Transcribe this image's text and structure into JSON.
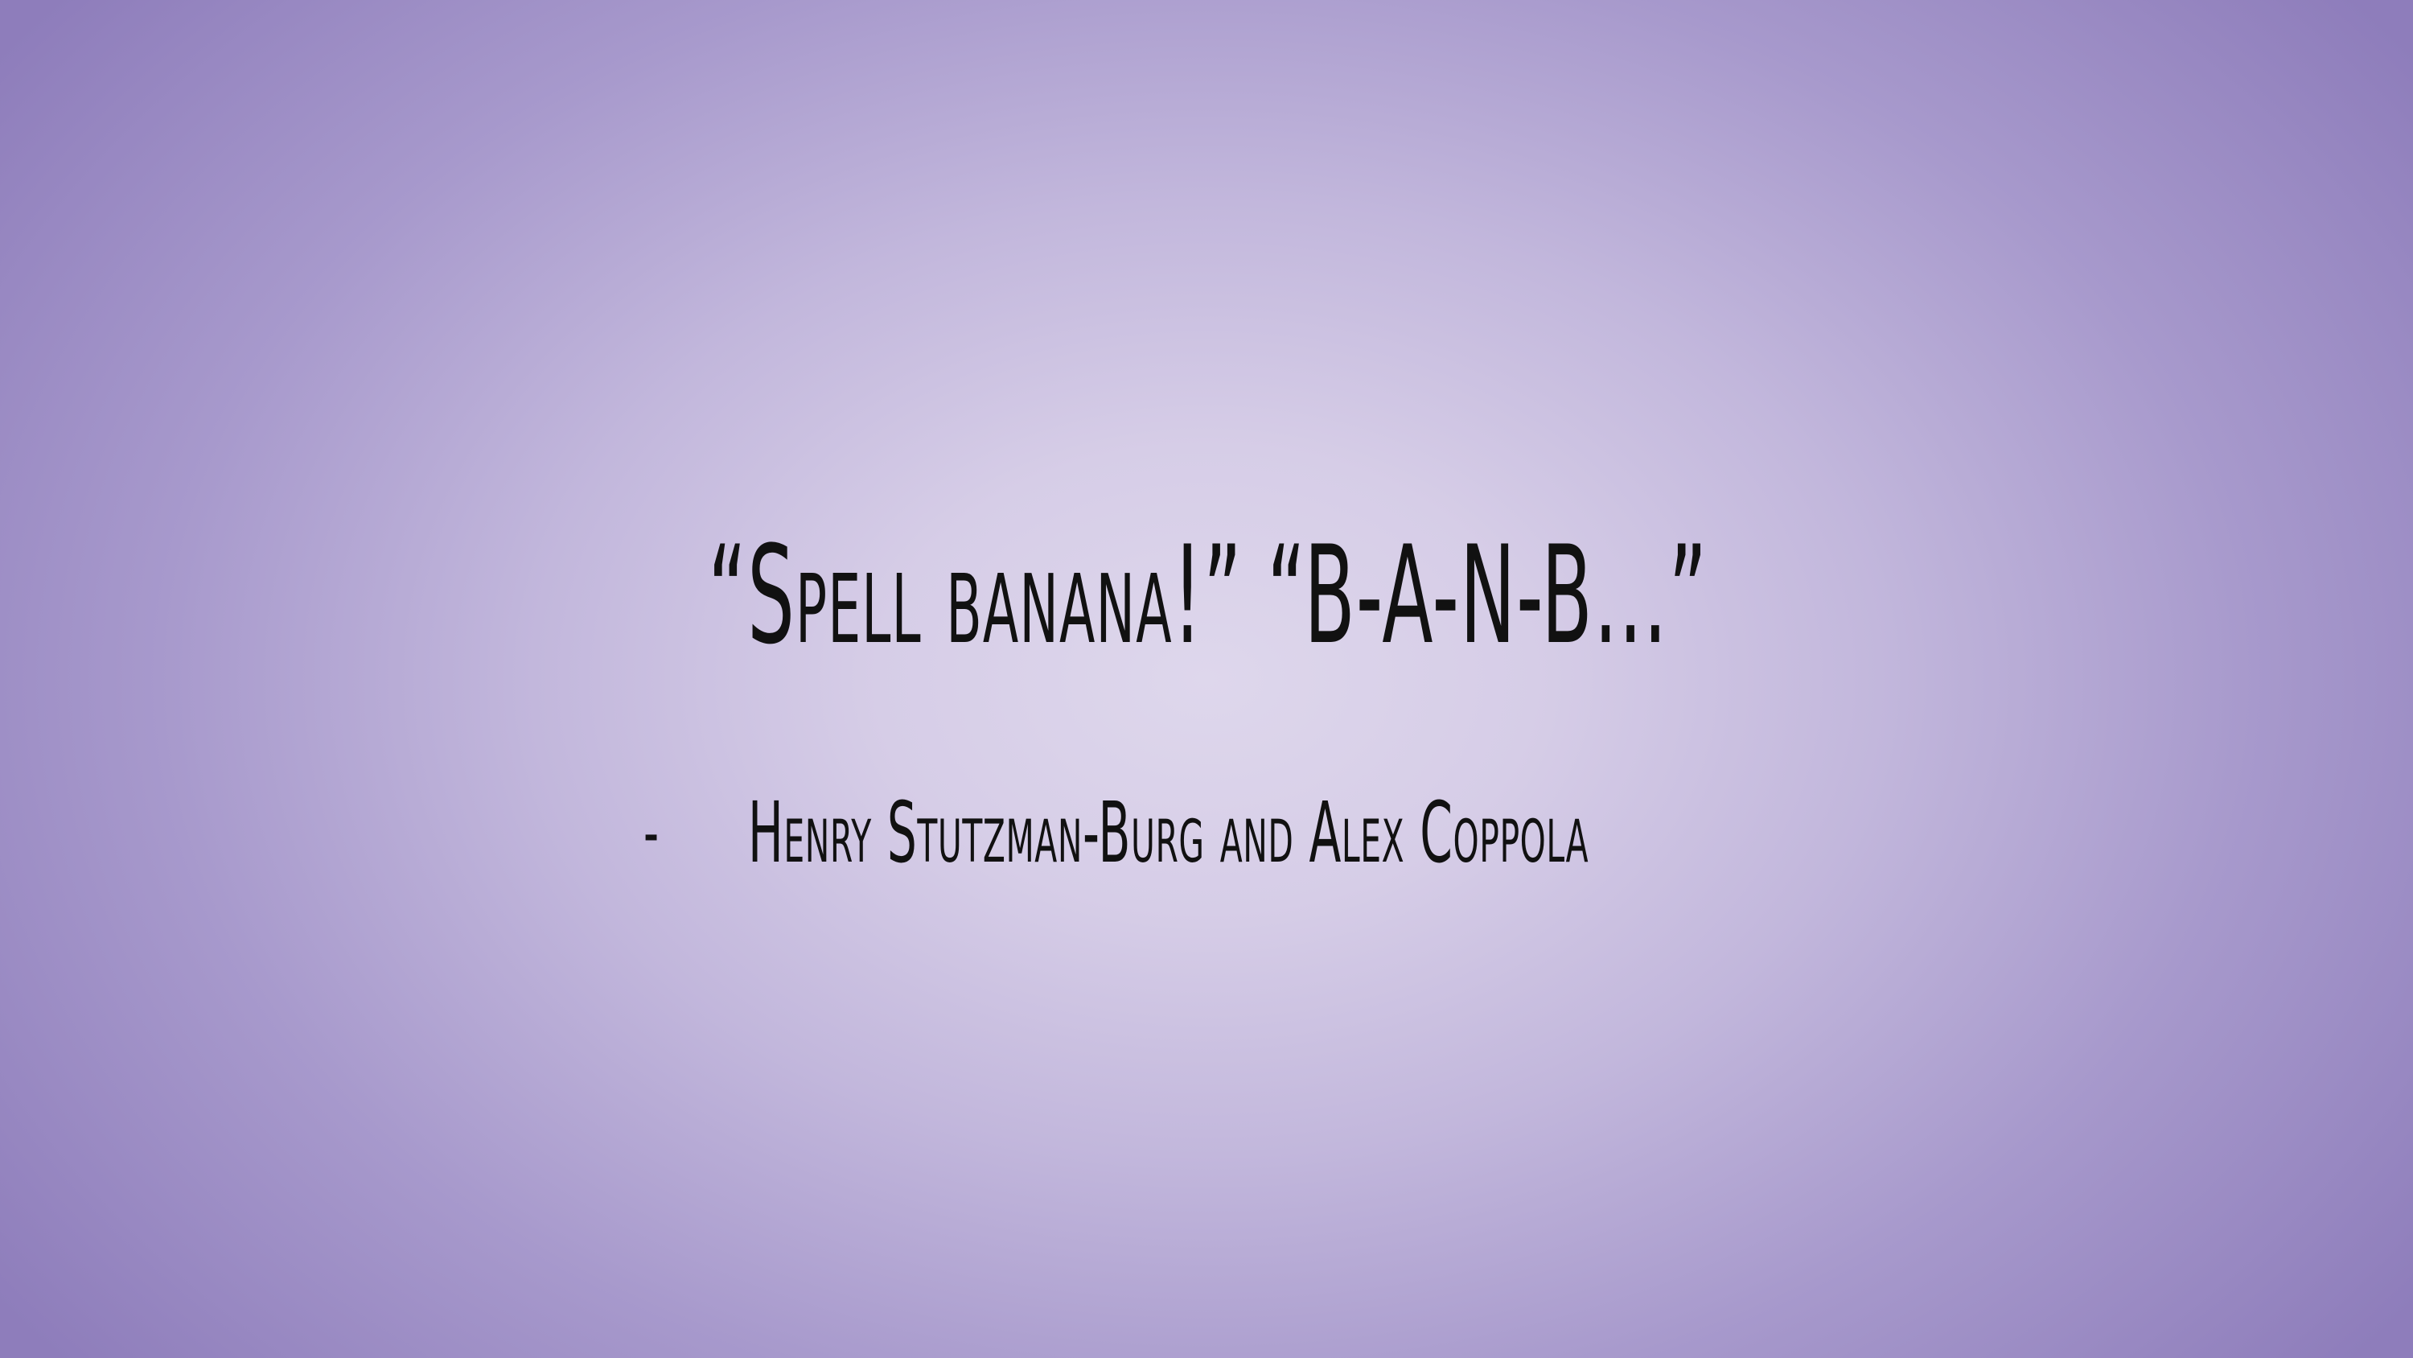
{
  "slide": {
    "quote": "“Spell banana!” “B-A-N-B…”",
    "attribution_marker": "-",
    "attribution": "Henry Stutzman-Burg and Alex Coppola"
  },
  "colors": {
    "background_center": "#ded7ec",
    "background_edge": "#8e7dbb",
    "text": "#111111"
  }
}
